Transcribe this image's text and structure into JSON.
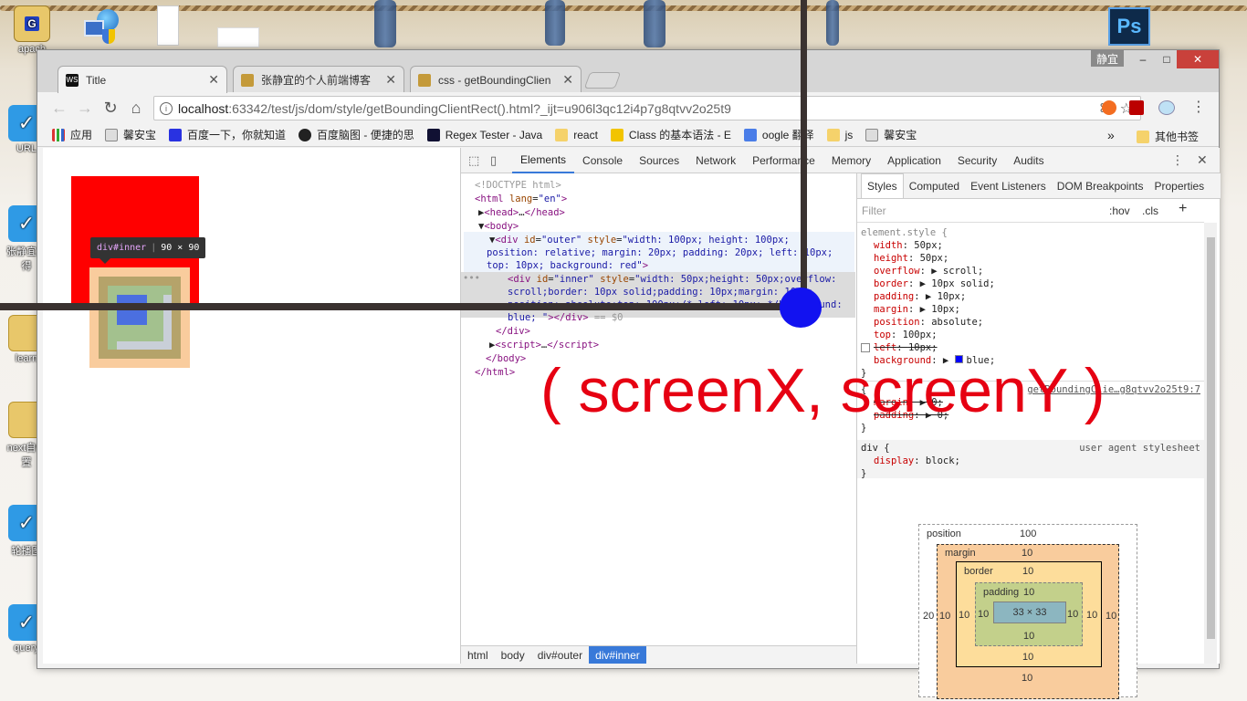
{
  "desktop": {
    "icons": [
      {
        "label": "apach",
        "icon": "apache-folder-icon"
      },
      {
        "label": "URL",
        "icon": "url-app-icon"
      },
      {
        "label": "张静宜心得",
        "icon": "notes-app-icon"
      },
      {
        "label": "learn",
        "icon": "folder-icon"
      },
      {
        "label": "next自位置",
        "icon": "folder-icon"
      },
      {
        "label": "轮播图",
        "icon": "carousel-app-icon"
      },
      {
        "label": "query",
        "icon": "query-app-icon"
      }
    ],
    "ps_icon_text": "Ps"
  },
  "window": {
    "user_badge": "静宜",
    "minimize": "–",
    "maximize": "□",
    "close": "✕"
  },
  "tabs": [
    {
      "title": "Title",
      "favicon": "WS",
      "active": true
    },
    {
      "title": "张静宜的个人前端博客",
      "favicon": "blog-favicon",
      "active": false
    },
    {
      "title": "css - getBoundingClien",
      "favicon": "css-favicon",
      "active": false
    }
  ],
  "toolbar": {
    "url_host": "localhost",
    "url_rest": ":63342/test/js/dom/style/getBoundingClientRect().html?_ijt=u906l3qc12i4p7g8qtvv2o25t9"
  },
  "bookmarks": [
    {
      "label": "应用",
      "icon": "apps-grid-icon"
    },
    {
      "label": "馨安宝",
      "icon": "image-icon"
    },
    {
      "label": "百度一下，你就知道",
      "icon": "baidu-paw-icon"
    },
    {
      "label": "百度脑图 - 便捷的思",
      "icon": "brain-map-icon"
    },
    {
      "label": "Regex Tester - Java",
      "icon": "regex-icon"
    },
    {
      "label": "react",
      "icon": "folder-icon"
    },
    {
      "label": "Class 的基本语法 - E",
      "icon": "es-icon"
    },
    {
      "label": "oogle 翻译",
      "icon": "translate-icon"
    },
    {
      "label": "js",
      "icon": "folder-icon"
    },
    {
      "label": "馨安宝",
      "icon": "image-icon"
    }
  ],
  "bookmarks_more": "»",
  "bookmarks_other": "其他书签",
  "page": {
    "tooltip_tag": "div#inner",
    "tooltip_size": "90 × 90"
  },
  "devtools": {
    "tabs": [
      "Elements",
      "Console",
      "Sources",
      "Network",
      "Performance",
      "Memory",
      "Application",
      "Security",
      "Audits"
    ],
    "active_tab": "Elements",
    "crumbs": [
      "html",
      "body",
      "div#outer",
      "div#inner"
    ],
    "sidebar_tabs": [
      "Styles",
      "Computed",
      "Event Listeners",
      "DOM Breakpoints",
      "Properties"
    ],
    "filter_placeholder": "Filter",
    "hov": ":hov",
    "cls": ".cls",
    "element_style": {
      "selector": "element.style {",
      "props": [
        {
          "name": "width",
          "value": "50px;"
        },
        {
          "name": "height",
          "value": "50px;"
        },
        {
          "name": "overflow",
          "value": "scroll;",
          "arrow": true
        },
        {
          "name": "border",
          "value": "10px solid;",
          "arrow": true
        },
        {
          "name": "padding",
          "value": "10px;",
          "arrow": true
        },
        {
          "name": "margin",
          "value": "10px;",
          "arrow": true
        },
        {
          "name": "position",
          "value": "absolute;"
        },
        {
          "name": "top",
          "value": "100px;"
        },
        {
          "name": "left",
          "value": "10px;",
          "disabled": true
        },
        {
          "name": "background",
          "value": "blue;",
          "arrow": true,
          "swatch": "#0000ff"
        }
      ]
    },
    "rule2": {
      "source": "getBoundingClie…g8qtvv2o25t9:7",
      "props": [
        {
          "name": "margin",
          "value": "0;"
        },
        {
          "name": "padding",
          "value": "0;"
        }
      ]
    },
    "rule3": {
      "selector": "div {",
      "origin": "user agent stylesheet",
      "prop": "display",
      "value": "block;"
    },
    "box_model": {
      "position": "position",
      "position_top": "100",
      "position_left": "20",
      "margin": "margin",
      "border": "border",
      "padding": "padding",
      "value": "10",
      "content": "33 × 33"
    }
  },
  "annotation": "( screenX, screenY )"
}
